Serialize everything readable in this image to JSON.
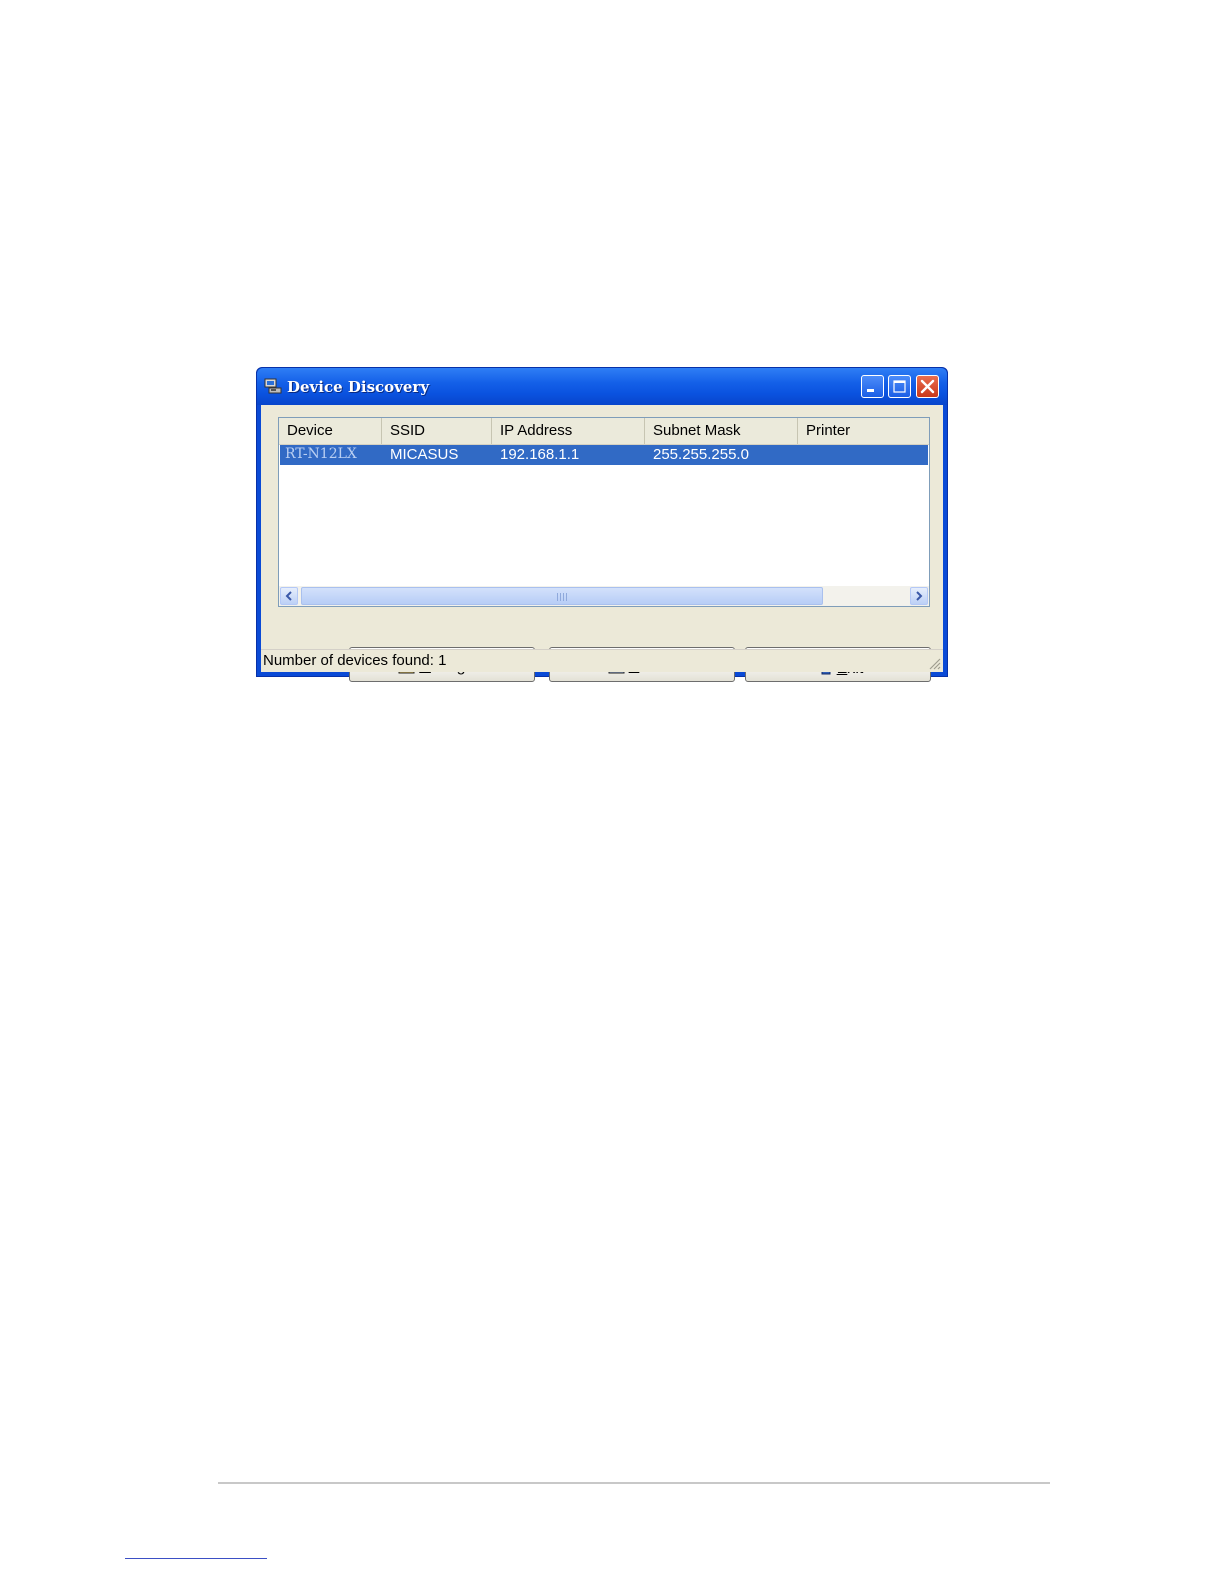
{
  "window": {
    "title": "Device Discovery",
    "icons": {
      "app": "network-computer-icon",
      "minimize": "minimize-icon",
      "maximize": "maximize-icon",
      "close": "close-icon"
    }
  },
  "device_list": {
    "columns": [
      "Device",
      "SSID",
      "IP Address",
      "Subnet Mask",
      "Printer"
    ],
    "rows": [
      {
        "device": "RT-N12LX",
        "ssid": "MICASUS",
        "ip_address": "192.168.1.1",
        "subnet_mask": "255.255.255.0",
        "printer": "",
        "selected": true
      }
    ],
    "selection_color": "#316AC5"
  },
  "buttons": {
    "configure": {
      "mnemonic": "C",
      "rest": "onfigure",
      "icon": "configure-icon"
    },
    "search": {
      "mnemonic": "S",
      "rest": "earch",
      "icon": "search-icon"
    },
    "exit": {
      "mnemonic": "E",
      "rest": "xit",
      "icon": "exit-door-icon"
    }
  },
  "status_bar": {
    "text": "Number of devices found: 1"
  },
  "colors": {
    "titlebar": "#0A52DF",
    "client": "#ECE9D8",
    "close_button": "#C9381A"
  }
}
